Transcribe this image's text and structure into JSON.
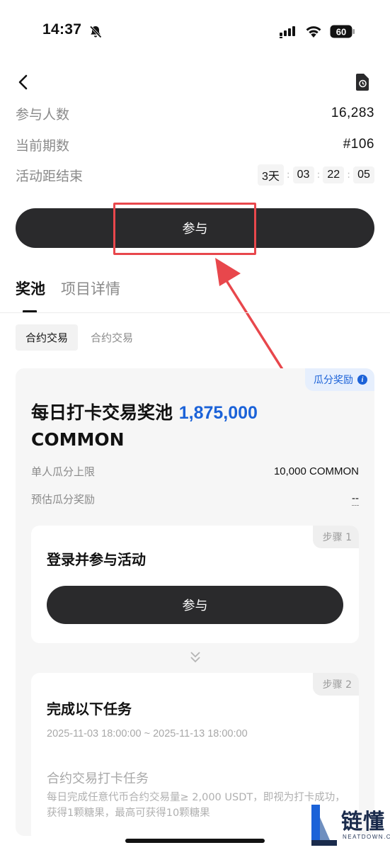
{
  "status_bar": {
    "time": "14:37",
    "battery": "60"
  },
  "info": {
    "participants_label": "参与人数",
    "participants_value": "16,283",
    "period_label": "当前期数",
    "period_value": "#106",
    "countdown_label": "活动距结束",
    "countdown": {
      "days": "3天",
      "hours": "03",
      "minutes": "22",
      "seconds": "05"
    }
  },
  "join_button": "参与",
  "tabs": [
    {
      "label": "奖池",
      "active": true
    },
    {
      "label": "项目详情",
      "active": false
    }
  ],
  "subtabs": [
    {
      "label": "合约交易",
      "active": true
    },
    {
      "label": "合约交易",
      "active": false
    }
  ],
  "pool": {
    "badge": "瓜分奖励",
    "title_prefix": "每日打卡交易奖池",
    "amount": "1,875,000",
    "token": "COMMON",
    "cap_label": "单人瓜分上限",
    "cap_value": "10,000 COMMON",
    "estimate_label": "预估瓜分奖励",
    "estimate_value": "--"
  },
  "step1": {
    "tag": "步骤 1",
    "title": "登录并参与活动",
    "button": "参与"
  },
  "step2": {
    "tag": "步骤 2",
    "title": "完成以下任务",
    "period": "2025-11-03 18:00:00 ~ 2025-11-13 18:00:00",
    "task_title": "合约交易打卡任务",
    "task_desc": "每日完成任意代币合约交易量≥ 2,000 USDT，即视为打卡成功，获得1颗糖果，最高可获得10颗糖果"
  },
  "watermark": {
    "text": "链懂",
    "sub": "NEATDOWN.COM"
  },
  "colors": {
    "accent": "#1b62d8",
    "button": "#2a2a2c",
    "highlight": "#e8474c"
  }
}
